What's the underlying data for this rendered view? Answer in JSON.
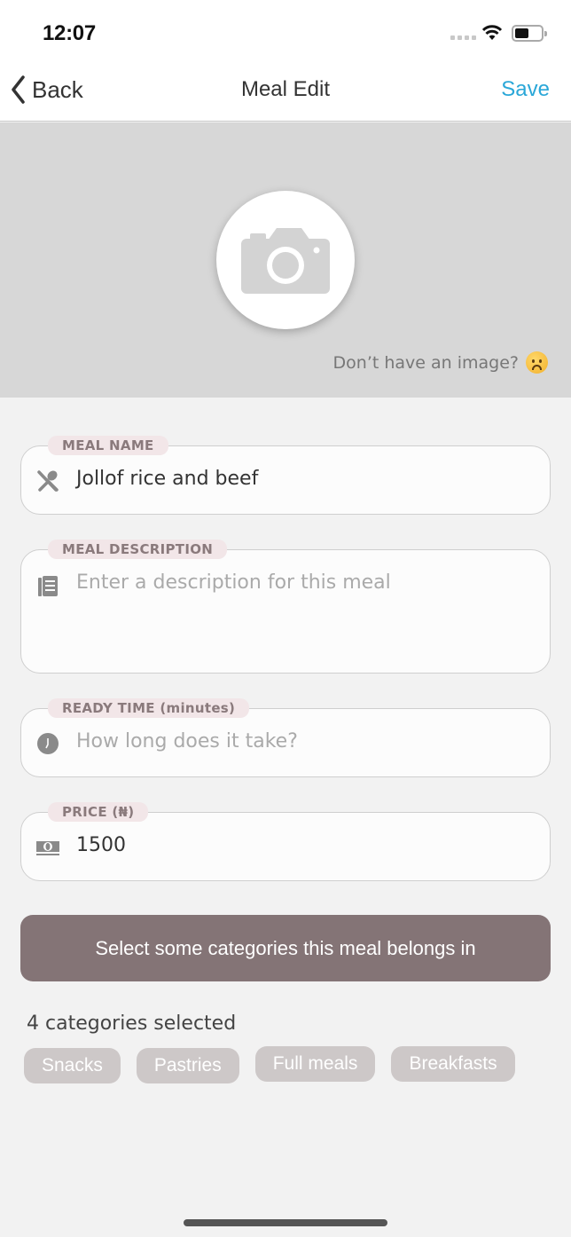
{
  "status_bar": {
    "time": "12:07"
  },
  "nav": {
    "back_label": "Back",
    "title": "Meal Edit",
    "save_label": "Save",
    "accent_color": "#2aa7d8"
  },
  "image_section": {
    "no_image_text": "Don’t have an image?",
    "emoji": "sad-face"
  },
  "fields": [
    {
      "label": "MEAL NAME",
      "icon": "cutlery-icon",
      "value": "Jollof rice and beef",
      "placeholder": ""
    },
    {
      "label": "MEAL DESCRIPTION",
      "icon": "document-icon",
      "value": "",
      "placeholder": "Enter a description for this meal"
    },
    {
      "label": "READY TIME (minutes)",
      "icon": "clock-icon",
      "value": "",
      "placeholder": "How long does it take?"
    },
    {
      "label": "PRICE (₦)",
      "icon": "cash-icon",
      "value": "1500",
      "placeholder": ""
    }
  ],
  "categories": {
    "button_label": "Select some categories this meal belongs in",
    "button_color": "#847476",
    "count_text": "4 categories selected",
    "selected": [
      "Snacks",
      "Pastries",
      "Full meals",
      "Breakfasts"
    ]
  }
}
